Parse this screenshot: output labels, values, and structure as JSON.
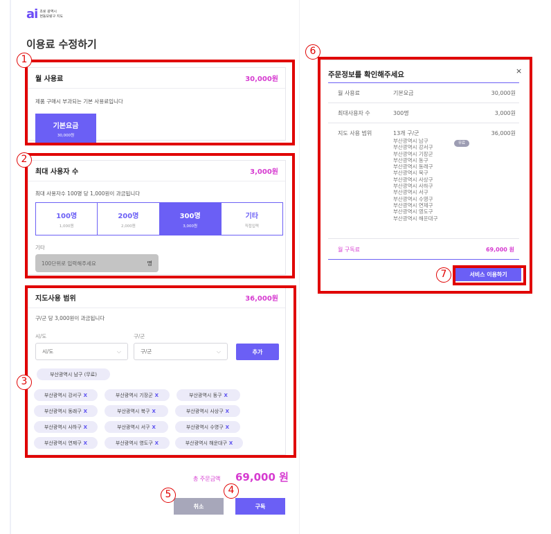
{
  "brand": {
    "logo_mark": "ai",
    "logo_line1": "초로 광역시",
    "logo_line2": "현동보랑구 지도"
  },
  "page_title": "이용료 수정하기",
  "annotations": [
    "1",
    "2",
    "3",
    "4",
    "5",
    "6",
    "7"
  ],
  "monthly": {
    "title": "월 사용료",
    "price": "30,000원",
    "desc": "제품 구매시 부과되는 기본 사용료입니다",
    "base_label": "기본요금",
    "base_price": "30,000원"
  },
  "users": {
    "title": "최대 사용자 수",
    "price": "3,000원",
    "desc": "최대 사용자수 100명 당 1,000원이 과금됩니다",
    "options": [
      {
        "label": "100명",
        "sub": "1,000원",
        "selected": false
      },
      {
        "label": "200명",
        "sub": "2,000원",
        "selected": false
      },
      {
        "label": "300명",
        "sub": "3,000원",
        "selected": true
      },
      {
        "label": "기타",
        "sub": "직접입력",
        "selected": false
      }
    ],
    "etc_label": "기타",
    "etc_placeholder": "100단위로 입력해주세요",
    "etc_unit": "명"
  },
  "map": {
    "title": "지도사용 범위",
    "price": "36,000원",
    "desc": "구/군 당 3,000원이 과금됩니다",
    "sido_label": "시/도",
    "sido_placeholder": "시/도",
    "gugun_label": "구/군",
    "gugun_placeholder": "구/군",
    "add_label": "추가",
    "free_chip": "부산광역시 남구 (무료)",
    "chips": [
      "부산광역시 강서구",
      "부산광역시 기장군",
      "부산광역시 동구",
      "부산광역시 동래구",
      "부산광역시 북구",
      "부산광역시 사상구",
      "부산광역시 사하구",
      "부산광역시 서구",
      "부산광역시 수영구",
      "부산광역시 연제구",
      "부산광역시 영도구",
      "부산광역시 해운대구"
    ],
    "chip_remove": "X"
  },
  "footer": {
    "total_label": "총 주문금액",
    "total_value": "69,000 원",
    "cancel_label": "취소",
    "subscribe_label": "구독"
  },
  "modal": {
    "title": "주문정보를 확인해주세요",
    "close": "×",
    "rows": [
      {
        "label": "월 사용료",
        "value": "기본요금",
        "price": "30,000원"
      },
      {
        "label": "최대사용자 수",
        "value": "300명",
        "price": "3,000원"
      },
      {
        "label": "지도 사용 범위",
        "value": "13개 구/군",
        "price": "36,000원"
      }
    ],
    "districts": [
      "부산광역시 남구",
      "부산광역시 강서구",
      "부산광역시 기장군",
      "부산광역시 동구",
      "부산광역시 동래구",
      "부산광역시 북구",
      "부산광역시 사상구",
      "부산광역시 사하구",
      "부산광역시 서구",
      "부산광역시 수영구",
      "부산광역시 연제구",
      "부산광역시 영도구",
      "부산광역시 해운대구"
    ],
    "free_badge": "무료",
    "total_label": "월 구독료",
    "total_value": "69,000 원",
    "service_label": "서비스 이용하기"
  },
  "colors": {
    "accent": "#6b5ff5",
    "price": "#d63bd0",
    "highlight": "#e00000"
  }
}
